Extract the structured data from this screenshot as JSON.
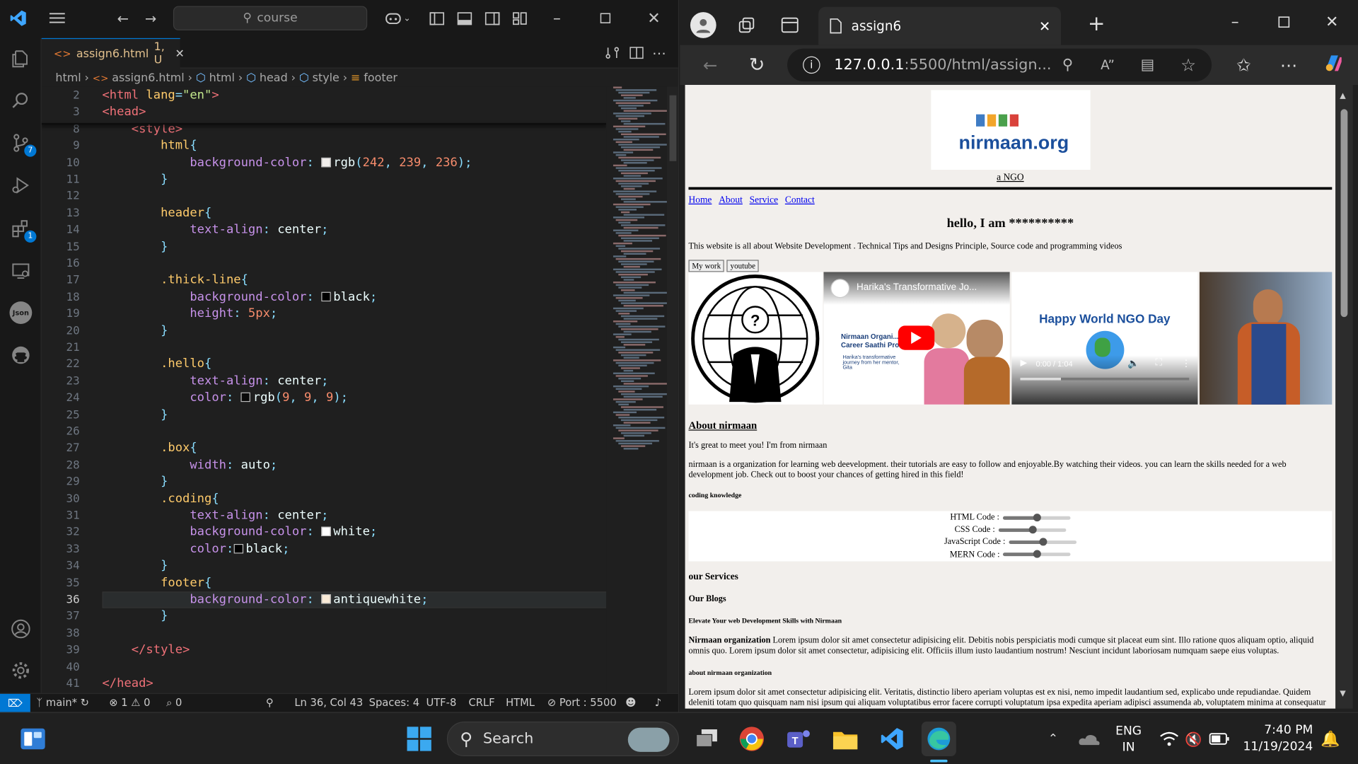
{
  "vscode": {
    "search_text": "course",
    "tab": {
      "label": "assign6.html",
      "badge": "1, U"
    },
    "breadcrumb": [
      "html",
      "assign6.html",
      "html",
      "head",
      "style",
      "footer"
    ],
    "activity_badges": {
      "scm": "7",
      "extensions": "1"
    },
    "code_lines": [
      {
        "n": "2",
        "tokens": [
          [
            "t",
            "<html "
          ],
          [
            "k",
            "lang"
          ],
          [
            "p",
            "="
          ],
          [
            "s",
            "\"en\""
          ],
          [
            "t",
            ">"
          ]
        ]
      },
      {
        "n": "3",
        "tokens": [
          [
            "t",
            "<head>"
          ]
        ]
      },
      {
        "n": "8",
        "tokens": [
          [
            "w",
            "    "
          ],
          [
            "t",
            "<style>"
          ]
        ]
      },
      {
        "n": "9",
        "tokens": [
          [
            "w",
            "        "
          ],
          [
            "k",
            "html"
          ],
          [
            "p",
            "{"
          ]
        ]
      },
      {
        "n": "10",
        "tokens": [
          [
            "w",
            "            "
          ],
          [
            "v",
            "background-color"
          ],
          [
            "p",
            ": "
          ],
          [
            "sw",
            "#f2efec"
          ],
          [
            "w",
            "rgb"
          ],
          [
            "p",
            "("
          ],
          [
            "n",
            "242"
          ],
          [
            "p",
            ", "
          ],
          [
            "n",
            "239"
          ],
          [
            "p",
            ", "
          ],
          [
            "n",
            "236"
          ],
          [
            "p",
            ");"
          ]
        ]
      },
      {
        "n": "11",
        "tokens": [
          [
            "w",
            "        "
          ],
          [
            "p",
            "}"
          ]
        ]
      },
      {
        "n": "12",
        "tokens": []
      },
      {
        "n": "13",
        "tokens": [
          [
            "w",
            "        "
          ],
          [
            "k",
            "header"
          ],
          [
            "p",
            "{"
          ]
        ]
      },
      {
        "n": "14",
        "tokens": [
          [
            "w",
            "            "
          ],
          [
            "v",
            "text-align"
          ],
          [
            "p",
            ": "
          ],
          [
            "w",
            "center"
          ],
          [
            "p",
            ";"
          ]
        ]
      },
      {
        "n": "15",
        "tokens": [
          [
            "w",
            "        "
          ],
          [
            "p",
            "}"
          ]
        ]
      },
      {
        "n": "16",
        "tokens": []
      },
      {
        "n": "17",
        "tokens": [
          [
            "w",
            "        "
          ],
          [
            "k",
            ".thick-line"
          ],
          [
            "p",
            "{"
          ]
        ]
      },
      {
        "n": "18",
        "tokens": [
          [
            "w",
            "            "
          ],
          [
            "v",
            "background-color"
          ],
          [
            "p",
            ": "
          ],
          [
            "sw",
            "#000000"
          ],
          [
            "w",
            "black"
          ],
          [
            "p",
            ";"
          ]
        ]
      },
      {
        "n": "19",
        "tokens": [
          [
            "w",
            "            "
          ],
          [
            "v",
            "height"
          ],
          [
            "p",
            ": "
          ],
          [
            "n",
            "5px"
          ],
          [
            "p",
            ";"
          ]
        ]
      },
      {
        "n": "20",
        "tokens": [
          [
            "w",
            "        "
          ],
          [
            "p",
            "}"
          ]
        ]
      },
      {
        "n": "21",
        "tokens": []
      },
      {
        "n": "22",
        "tokens": [
          [
            "w",
            "        "
          ],
          [
            "k",
            ".hello"
          ],
          [
            "p",
            "{"
          ]
        ]
      },
      {
        "n": "23",
        "tokens": [
          [
            "w",
            "            "
          ],
          [
            "v",
            "text-align"
          ],
          [
            "p",
            ": "
          ],
          [
            "w",
            "center"
          ],
          [
            "p",
            ";"
          ]
        ]
      },
      {
        "n": "24",
        "tokens": [
          [
            "w",
            "            "
          ],
          [
            "v",
            "color"
          ],
          [
            "p",
            ": "
          ],
          [
            "sw",
            "#090909"
          ],
          [
            "w",
            "rgb"
          ],
          [
            "p",
            "("
          ],
          [
            "n",
            "9"
          ],
          [
            "p",
            ", "
          ],
          [
            "n",
            "9"
          ],
          [
            "p",
            ", "
          ],
          [
            "n",
            "9"
          ],
          [
            "p",
            ");"
          ]
        ]
      },
      {
        "n": "25",
        "tokens": [
          [
            "w",
            "        "
          ],
          [
            "p",
            "}"
          ]
        ]
      },
      {
        "n": "26",
        "tokens": []
      },
      {
        "n": "27",
        "tokens": [
          [
            "w",
            "        "
          ],
          [
            "k",
            ".box"
          ],
          [
            "p",
            "{"
          ]
        ]
      },
      {
        "n": "28",
        "tokens": [
          [
            "w",
            "            "
          ],
          [
            "v",
            "width"
          ],
          [
            "p",
            ": "
          ],
          [
            "w",
            "auto"
          ],
          [
            "p",
            ";"
          ]
        ]
      },
      {
        "n": "29",
        "tokens": [
          [
            "w",
            "        "
          ],
          [
            "p",
            "}"
          ]
        ]
      },
      {
        "n": "30",
        "tokens": [
          [
            "w",
            "        "
          ],
          [
            "k",
            ".coding"
          ],
          [
            "p",
            "{"
          ]
        ]
      },
      {
        "n": "31",
        "tokens": [
          [
            "w",
            "            "
          ],
          [
            "v",
            "text-align"
          ],
          [
            "p",
            ": "
          ],
          [
            "w",
            "center"
          ],
          [
            "p",
            ";"
          ]
        ]
      },
      {
        "n": "32",
        "tokens": [
          [
            "w",
            "            "
          ],
          [
            "v",
            "background-color"
          ],
          [
            "p",
            ": "
          ],
          [
            "sw",
            "#ffffff"
          ],
          [
            "w",
            "white"
          ],
          [
            "p",
            ";"
          ]
        ]
      },
      {
        "n": "33",
        "tokens": [
          [
            "w",
            "            "
          ],
          [
            "v",
            "color"
          ],
          [
            "p",
            ":"
          ],
          [
            "sw",
            "#000000"
          ],
          [
            "w",
            "black"
          ],
          [
            "p",
            ";"
          ]
        ]
      },
      {
        "n": "34",
        "tokens": [
          [
            "w",
            "        "
          ],
          [
            "p",
            "}"
          ]
        ]
      },
      {
        "n": "35",
        "tokens": [
          [
            "w",
            "        "
          ],
          [
            "k",
            "footer"
          ],
          [
            "p",
            "{"
          ]
        ]
      },
      {
        "n": "36",
        "tokens": [
          [
            "w",
            "            "
          ],
          [
            "v",
            "background-color"
          ],
          [
            "p",
            ": "
          ],
          [
            "sw",
            "#faebd7"
          ],
          [
            "w",
            "antiquewhite"
          ],
          [
            "p",
            ";"
          ]
        ]
      },
      {
        "n": "37",
        "tokens": [
          [
            "w",
            "        "
          ],
          [
            "p",
            "}"
          ]
        ]
      },
      {
        "n": "38",
        "tokens": []
      },
      {
        "n": "39",
        "tokens": [
          [
            "w",
            "    "
          ],
          [
            "t",
            "</style>"
          ]
        ]
      },
      {
        "n": "40",
        "tokens": []
      },
      {
        "n": "41",
        "tokens": [
          [
            "t",
            "</head>"
          ]
        ]
      }
    ],
    "active_line": "36",
    "status": {
      "branch": "main*",
      "problems_errors": "1",
      "problems_warnings": "0",
      "ports": "0",
      "cursor": "Ln 36, Col 43",
      "spaces": "Spaces: 4",
      "encoding": "UTF-8",
      "eol": "CRLF",
      "language": "HTML",
      "port": "Port : 5500"
    }
  },
  "edge": {
    "tab_title": "assign6",
    "url_host": "127.0.0.1",
    "url_rest": ":5500/html/assign...",
    "page": {
      "logo_text": "nirmaan.org",
      "tagline": "a NGO",
      "nav": [
        "Home",
        "About",
        "Service",
        "Contact"
      ],
      "hello": "hello, I am **********",
      "intro": "This website is all about Website Development . Technical Tips and Designs Principle, Source code and programming videos",
      "buttons": [
        "My work",
        "youtube"
      ],
      "video1_title": "Harika's Transformative Jo...",
      "video1_text1": "Nirmaan Organi...",
      "video1_text2": "Career Saathi Pro...",
      "video1_text3": "Harika's transformative journey from her mentor, Gita",
      "video2_title": "Happy World NGO Day",
      "video2_time": "0:00 / 1:04",
      "about_heading": "About nirmaan",
      "about_p1": "It's great to meet you! I'm from nirmaan",
      "about_p2": "nirmaan is a organization for learning web deevelopment. their tutorials are easy to follow and enjoyable.By watching their videos. you can learn the skills needed for a web development job. Check out to boost your chances of getting hired in this field!",
      "coding_heading": "coding knowledge",
      "skills": [
        {
          "label": "HTML Code :",
          "value": 0.5
        },
        {
          "label": "CSS Code :",
          "value": 0.5
        },
        {
          "label": "JavaScript Code :",
          "value": 0.5
        },
        {
          "label": "MERN Code :",
          "value": 0.5
        }
      ],
      "services_heading": "our Services",
      "blogs_heading": "Our Blogs",
      "blog_title": "Elevate Your web Development Skills with Nirmaan",
      "blog_lead": "Nirmaan organization",
      "blog_text": "Lorem ipsum dolor sit amet consectetur adipisicing elit. Debitis nobis perspiciatis modi cumque sit placeat eum sint. Illo ratione quos aliquam optio, aliquid omnis quo. Lorem ipsum dolor sit amet consectetur, adipisicing elit. Officiis illum iusto laudantium nostrum! Nesciunt incidunt laboriosam numquam saepe eius voluptas.",
      "about_org_heading": "about nirmaan organization",
      "about_org_text": "Lorem ipsum dolor sit amet consectetur adipisicing elit. Veritatis, distinctio libero aperiam voluptas est ex nisi, nemo impedit laudantium sed, explicabo unde repudiandae. Quidem deleniti totam quo quisquam nam nisi ipsum qui aliquam voluptatibus error facere corrupti voluptatum ipsa expedita aperiam adipisci assumenda ab, voluptatem minima at consequatur eius. Nemo"
    }
  },
  "taskbar": {
    "search_label": "Search",
    "lang1": "ENG",
    "lang2": "IN",
    "time": "7:40 PM",
    "date": "11/19/2024"
  },
  "colors": {
    "accent": "#0078d4",
    "page_bg": "#f2efec"
  }
}
